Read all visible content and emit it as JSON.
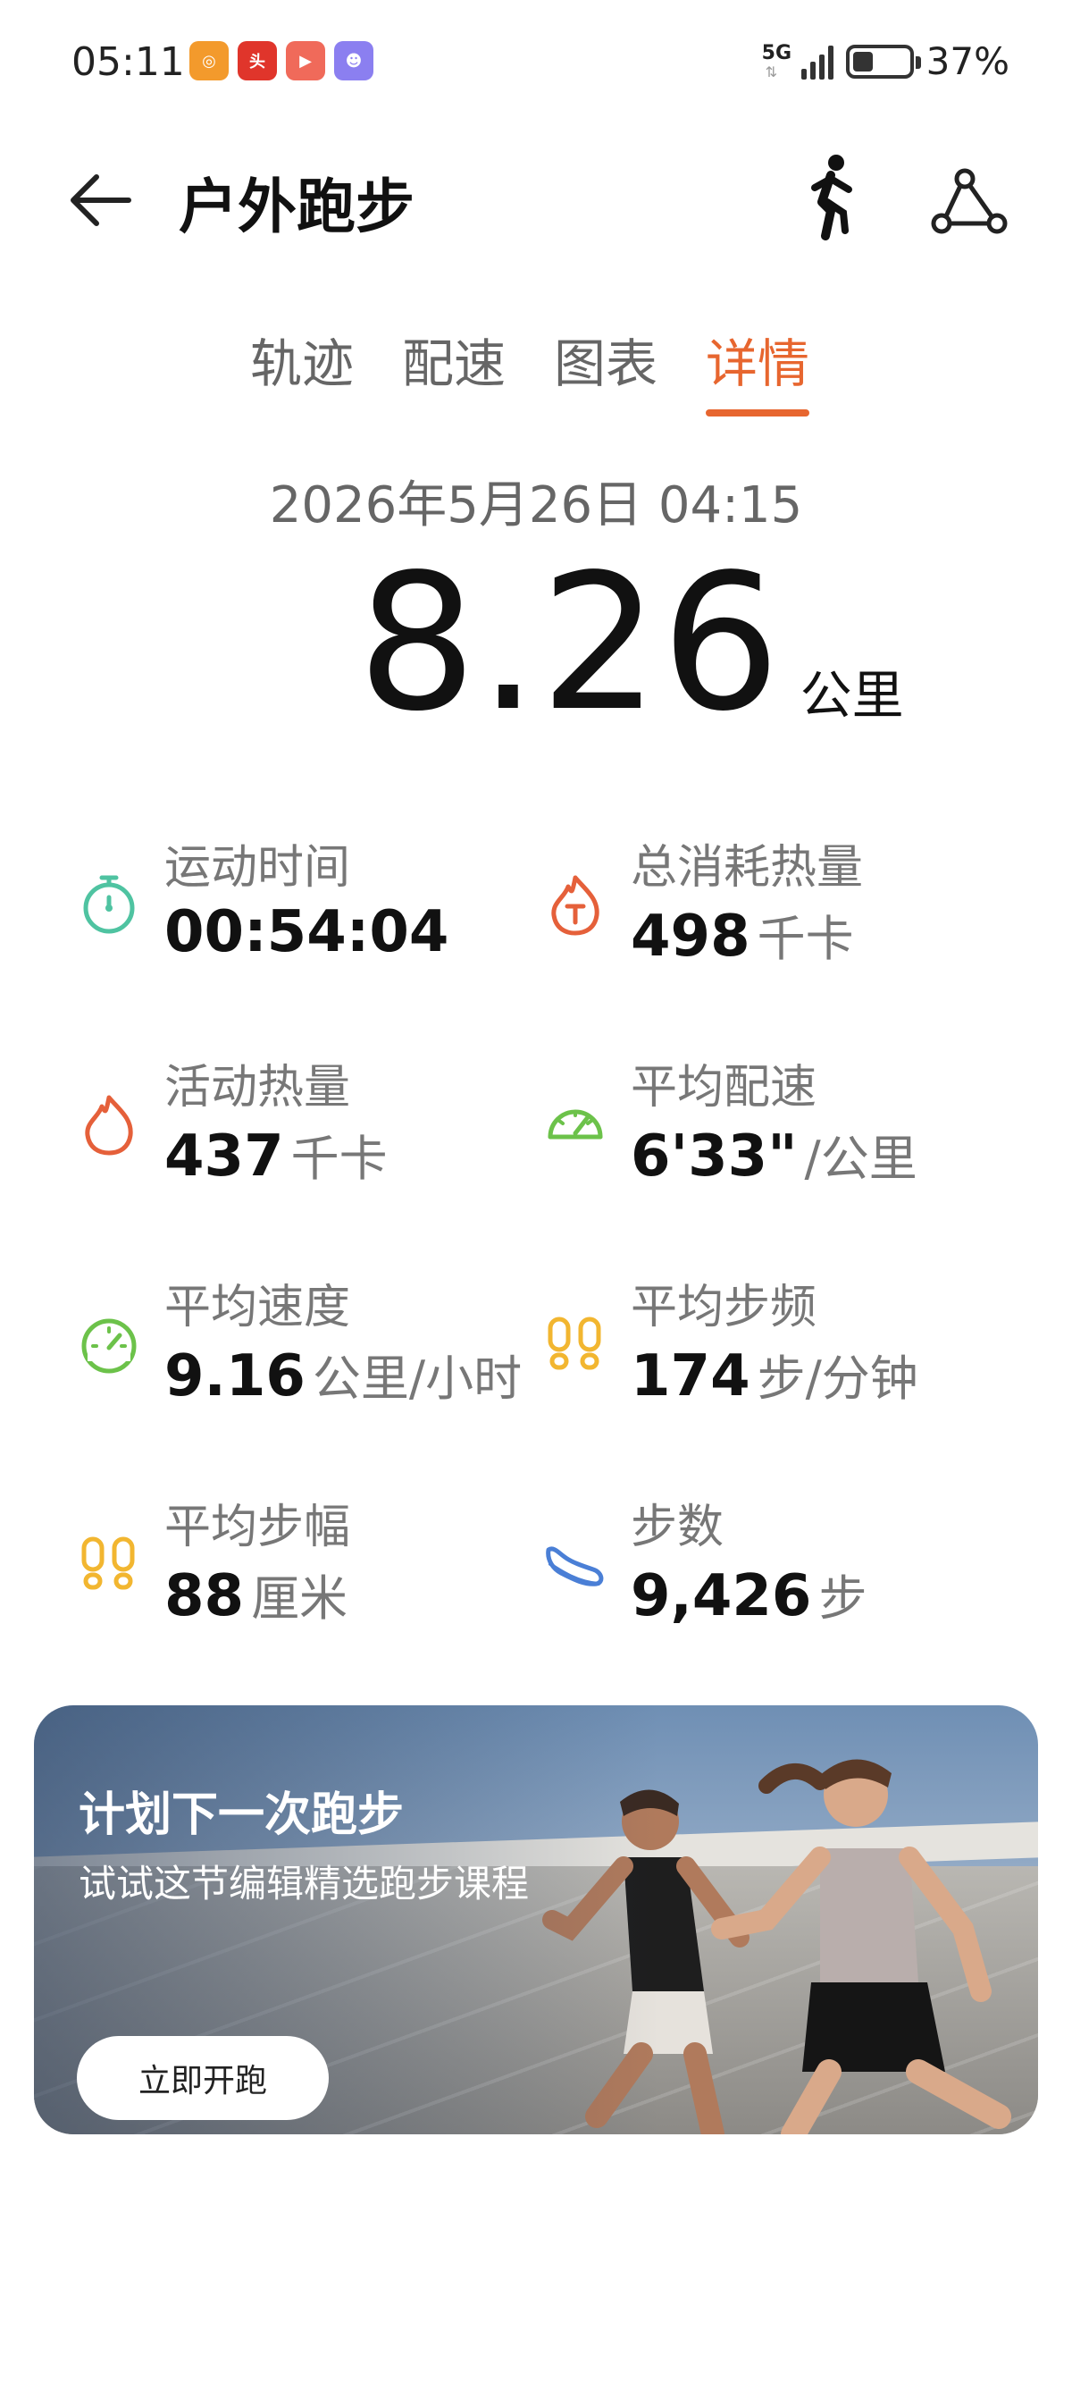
{
  "status_bar": {
    "time": "05:11",
    "network": "5G",
    "battery_percent": "37%",
    "battery_level": 0.37
  },
  "header": {
    "title": "户外跑步"
  },
  "tabs": [
    {
      "label": "轨迹",
      "active": false
    },
    {
      "label": "配速",
      "active": false
    },
    {
      "label": "图表",
      "active": false
    },
    {
      "label": "详情",
      "active": true
    }
  ],
  "summary": {
    "date": "2026年5月26日 04:15",
    "distance": "8.26",
    "distance_unit": "公里"
  },
  "metrics": [
    {
      "label": "运动时间",
      "value": "00:54:04",
      "unit": "",
      "icon": "stopwatch-icon",
      "color": "#4fc3a1"
    },
    {
      "label": "总消耗热量",
      "value": "498",
      "unit": "千卡",
      "icon": "total-calorie-icon",
      "color": "#e5603a"
    },
    {
      "label": "活动热量",
      "value": "437",
      "unit": "千卡",
      "icon": "flame-icon",
      "color": "#e5603a"
    },
    {
      "label": "平均配速",
      "value": "6'33\"",
      "unit": "/公里",
      "icon": "pace-gauge-icon",
      "color": "#6cc24a"
    },
    {
      "label": "平均速度",
      "value": "9.16",
      "unit": "公里/小时",
      "icon": "speed-gauge-icon",
      "color": "#6cc24a"
    },
    {
      "label": "平均步频",
      "value": "174",
      "unit": "步/分钟",
      "icon": "footprints-icon",
      "color": "#f2b630"
    },
    {
      "label": "平均步幅",
      "value": "88",
      "unit": "厘米",
      "icon": "footprints-icon",
      "color": "#f2b630"
    },
    {
      "label": "步数",
      "value": "9,426",
      "unit": "步",
      "icon": "shoe-icon",
      "color": "#4a7fd6"
    }
  ],
  "banner": {
    "title": "计划下一次跑步",
    "subtitle": "试试这节编辑精选跑步课程",
    "button_label": "立即开跑"
  },
  "colors": {
    "accent": "#e7662f"
  }
}
